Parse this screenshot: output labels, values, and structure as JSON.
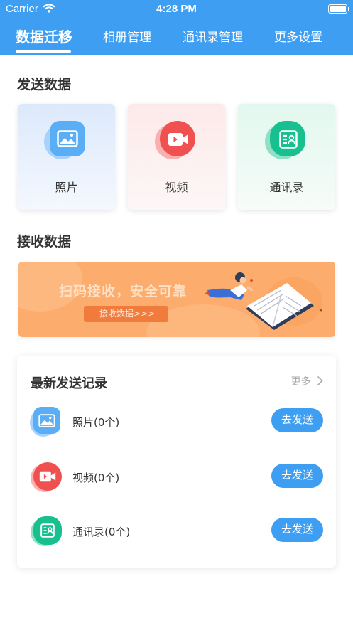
{
  "status_bar": {
    "carrier": "Carrier",
    "time": "4:28 PM"
  },
  "tabs": [
    {
      "label": "数据迁移",
      "active": true
    },
    {
      "label": "相册管理",
      "active": false
    },
    {
      "label": "通讯录管理",
      "active": false
    },
    {
      "label": "更多设置",
      "active": false
    }
  ],
  "send_section": {
    "title": "发送数据",
    "cards": [
      {
        "label": "照片",
        "icon": "image-icon"
      },
      {
        "label": "视频",
        "icon": "video-icon"
      },
      {
        "label": "通讯录",
        "icon": "contacts-icon"
      }
    ]
  },
  "receive_section": {
    "title": "接收数据",
    "banner_text": "扫码接收，安全可靠",
    "banner_button": "接收数据>>>"
  },
  "records": {
    "title": "最新发送记录",
    "more": "更多",
    "items": [
      {
        "label": "照片(0个)",
        "button": "去发送",
        "icon": "image-icon"
      },
      {
        "label": "视频(0个)",
        "button": "去发送",
        "icon": "video-icon"
      },
      {
        "label": "通讯录(0个)",
        "button": "去发送",
        "icon": "contacts-icon"
      }
    ]
  },
  "colors": {
    "primary": "#3d9ef2",
    "photo": "#5aaef5",
    "video": "#f05050",
    "contacts": "#18c08f",
    "banner": "#fcac6c"
  }
}
